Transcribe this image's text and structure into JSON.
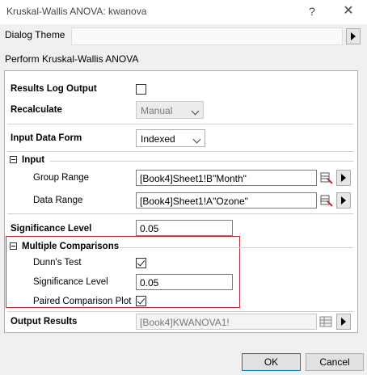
{
  "window": {
    "title": "Kruskal-Wallis ANOVA: kwanova",
    "help": "?",
    "close": "✕"
  },
  "theme": {
    "label": "Dialog Theme",
    "value": ""
  },
  "perform_label": "Perform Kruskal-Wallis ANOVA",
  "settings": {
    "results_log": {
      "label": "Results Log Output",
      "checked": false
    },
    "recalculate": {
      "label": "Recalculate",
      "value": "Manual"
    },
    "input_data_form": {
      "label": "Input Data Form",
      "value": "Indexed"
    },
    "input": {
      "label": "Input",
      "group_range": {
        "label": "Group Range",
        "value": "[Book4]Sheet1!B\"Month\""
      },
      "data_range": {
        "label": "Data Range",
        "value": "[Book4]Sheet1!A\"Ozone\""
      }
    },
    "significance_level": {
      "label": "Significance Level",
      "value": "0.05"
    },
    "multiple_comparisons": {
      "label": "Multiple Comparisons",
      "dunns_test": {
        "label": "Dunn's Test",
        "checked": true
      },
      "significance_level": {
        "label": "Significance Level",
        "value": "0.05"
      },
      "paired_plot": {
        "label": "Paired Comparison Plot",
        "checked": true
      }
    },
    "output_results": {
      "label": "Output Results",
      "value": "[Book4]KWANOVA1!"
    }
  },
  "buttons": {
    "ok": "OK",
    "cancel": "Cancel"
  },
  "colors": {
    "highlight_box": "#d9232e",
    "focus_border": "#0078d7"
  }
}
